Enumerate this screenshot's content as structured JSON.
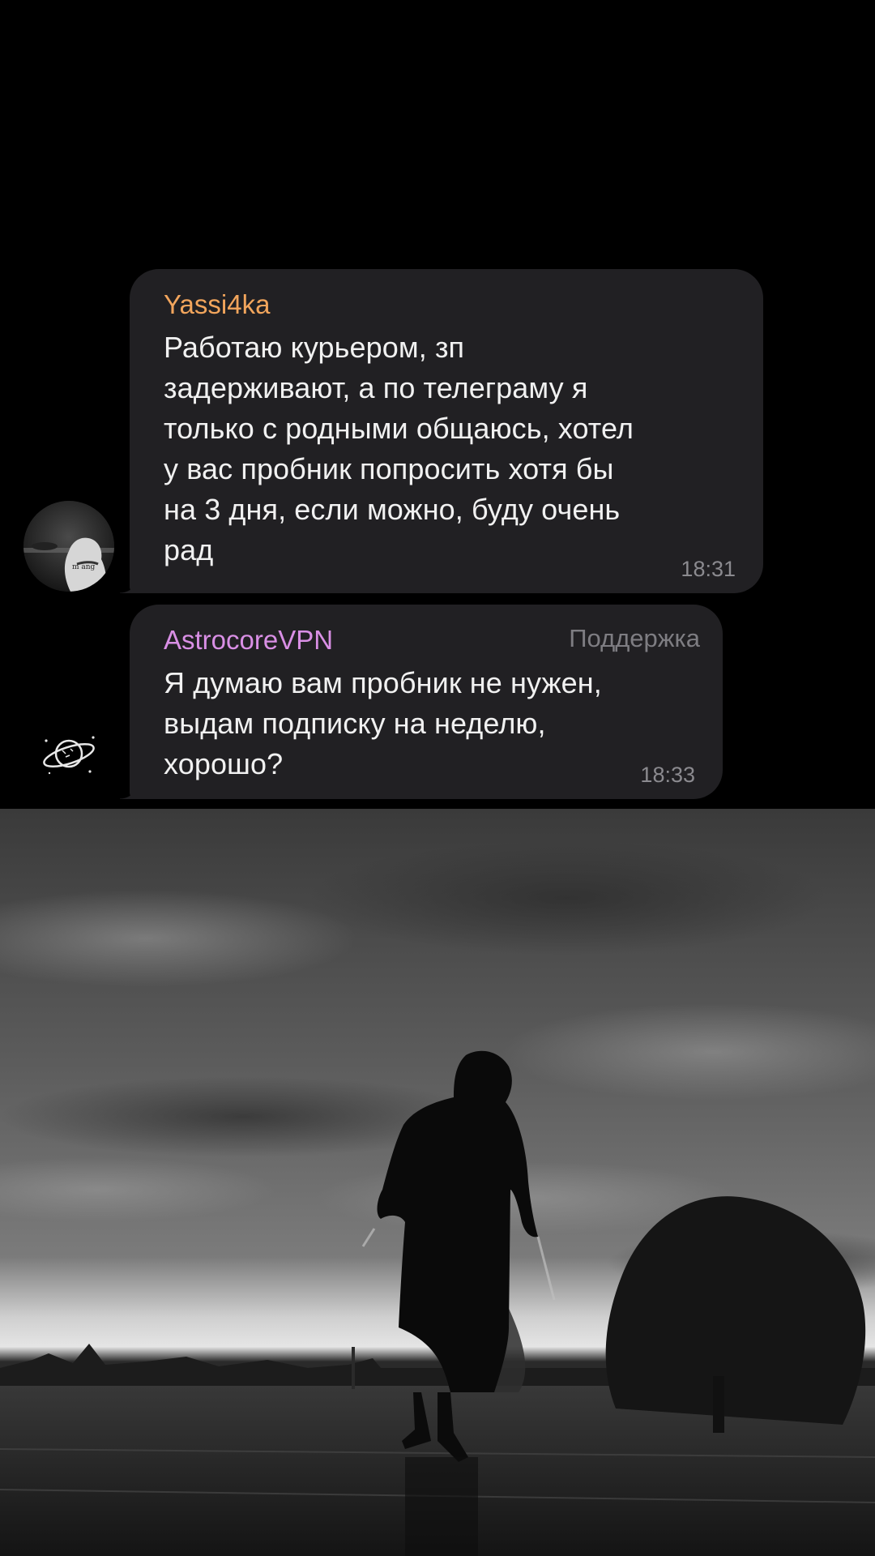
{
  "messages": [
    {
      "sender": "Yassi4ka",
      "sender_color": "#f2a55c",
      "text": "Работаю курьером, зп\nзадерживают, а по телеграму я\nтолько с родными общаюсь, хотел\nу вас пробник попросить хотя бы\nна 3 дня, если можно, буду очень\nрад",
      "time": "18:31",
      "avatar_icon": "hooded-person-avatar"
    },
    {
      "sender": "AstrocoreVPN",
      "sender_color": "#d98fe5",
      "role": "Поддержка",
      "text": "Я думаю вам пробник не нужен,\nвыдам подписку на неделю,\nхорошо?",
      "time": "18:33",
      "avatar_icon": "planet-logo-icon"
    }
  ],
  "colors": {
    "background": "#000000",
    "bubble": "#212023",
    "text": "#f1f1f1",
    "timestamp": "#8b8a8f"
  }
}
